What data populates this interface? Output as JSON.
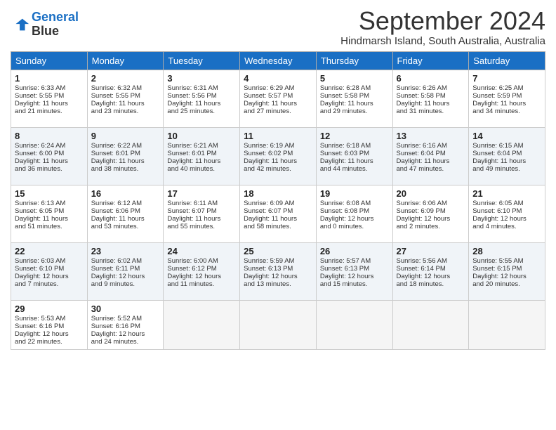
{
  "logo": {
    "line1": "General",
    "line2": "Blue"
  },
  "title": "September 2024",
  "location": "Hindmarsh Island, South Australia, Australia",
  "headers": [
    "Sunday",
    "Monday",
    "Tuesday",
    "Wednesday",
    "Thursday",
    "Friday",
    "Saturday"
  ],
  "weeks": [
    [
      {
        "day": "1",
        "sunrise": "Sunrise: 6:33 AM",
        "sunset": "Sunset: 5:55 PM",
        "daylight": "Daylight: 11 hours",
        "minutes": "and 21 minutes."
      },
      {
        "day": "2",
        "sunrise": "Sunrise: 6:32 AM",
        "sunset": "Sunset: 5:55 PM",
        "daylight": "Daylight: 11 hours",
        "minutes": "and 23 minutes."
      },
      {
        "day": "3",
        "sunrise": "Sunrise: 6:31 AM",
        "sunset": "Sunset: 5:56 PM",
        "daylight": "Daylight: 11 hours",
        "minutes": "and 25 minutes."
      },
      {
        "day": "4",
        "sunrise": "Sunrise: 6:29 AM",
        "sunset": "Sunset: 5:57 PM",
        "daylight": "Daylight: 11 hours",
        "minutes": "and 27 minutes."
      },
      {
        "day": "5",
        "sunrise": "Sunrise: 6:28 AM",
        "sunset": "Sunset: 5:58 PM",
        "daylight": "Daylight: 11 hours",
        "minutes": "and 29 minutes."
      },
      {
        "day": "6",
        "sunrise": "Sunrise: 6:26 AM",
        "sunset": "Sunset: 5:58 PM",
        "daylight": "Daylight: 11 hours",
        "minutes": "and 31 minutes."
      },
      {
        "day": "7",
        "sunrise": "Sunrise: 6:25 AM",
        "sunset": "Sunset: 5:59 PM",
        "daylight": "Daylight: 11 hours",
        "minutes": "and 34 minutes."
      }
    ],
    [
      {
        "day": "8",
        "sunrise": "Sunrise: 6:24 AM",
        "sunset": "Sunset: 6:00 PM",
        "daylight": "Daylight: 11 hours",
        "minutes": "and 36 minutes."
      },
      {
        "day": "9",
        "sunrise": "Sunrise: 6:22 AM",
        "sunset": "Sunset: 6:01 PM",
        "daylight": "Daylight: 11 hours",
        "minutes": "and 38 minutes."
      },
      {
        "day": "10",
        "sunrise": "Sunrise: 6:21 AM",
        "sunset": "Sunset: 6:01 PM",
        "daylight": "Daylight: 11 hours",
        "minutes": "and 40 minutes."
      },
      {
        "day": "11",
        "sunrise": "Sunrise: 6:19 AM",
        "sunset": "Sunset: 6:02 PM",
        "daylight": "Daylight: 11 hours",
        "minutes": "and 42 minutes."
      },
      {
        "day": "12",
        "sunrise": "Sunrise: 6:18 AM",
        "sunset": "Sunset: 6:03 PM",
        "daylight": "Daylight: 11 hours",
        "minutes": "and 44 minutes."
      },
      {
        "day": "13",
        "sunrise": "Sunrise: 6:16 AM",
        "sunset": "Sunset: 6:04 PM",
        "daylight": "Daylight: 11 hours",
        "minutes": "and 47 minutes."
      },
      {
        "day": "14",
        "sunrise": "Sunrise: 6:15 AM",
        "sunset": "Sunset: 6:04 PM",
        "daylight": "Daylight: 11 hours",
        "minutes": "and 49 minutes."
      }
    ],
    [
      {
        "day": "15",
        "sunrise": "Sunrise: 6:13 AM",
        "sunset": "Sunset: 6:05 PM",
        "daylight": "Daylight: 11 hours",
        "minutes": "and 51 minutes."
      },
      {
        "day": "16",
        "sunrise": "Sunrise: 6:12 AM",
        "sunset": "Sunset: 6:06 PM",
        "daylight": "Daylight: 11 hours",
        "minutes": "and 53 minutes."
      },
      {
        "day": "17",
        "sunrise": "Sunrise: 6:11 AM",
        "sunset": "Sunset: 6:07 PM",
        "daylight": "Daylight: 11 hours",
        "minutes": "and 55 minutes."
      },
      {
        "day": "18",
        "sunrise": "Sunrise: 6:09 AM",
        "sunset": "Sunset: 6:07 PM",
        "daylight": "Daylight: 11 hours",
        "minutes": "and 58 minutes."
      },
      {
        "day": "19",
        "sunrise": "Sunrise: 6:08 AM",
        "sunset": "Sunset: 6:08 PM",
        "daylight": "Daylight: 12 hours",
        "minutes": "and 0 minutes."
      },
      {
        "day": "20",
        "sunrise": "Sunrise: 6:06 AM",
        "sunset": "Sunset: 6:09 PM",
        "daylight": "Daylight: 12 hours",
        "minutes": "and 2 minutes."
      },
      {
        "day": "21",
        "sunrise": "Sunrise: 6:05 AM",
        "sunset": "Sunset: 6:10 PM",
        "daylight": "Daylight: 12 hours",
        "minutes": "and 4 minutes."
      }
    ],
    [
      {
        "day": "22",
        "sunrise": "Sunrise: 6:03 AM",
        "sunset": "Sunset: 6:10 PM",
        "daylight": "Daylight: 12 hours",
        "minutes": "and 7 minutes."
      },
      {
        "day": "23",
        "sunrise": "Sunrise: 6:02 AM",
        "sunset": "Sunset: 6:11 PM",
        "daylight": "Daylight: 12 hours",
        "minutes": "and 9 minutes."
      },
      {
        "day": "24",
        "sunrise": "Sunrise: 6:00 AM",
        "sunset": "Sunset: 6:12 PM",
        "daylight": "Daylight: 12 hours",
        "minutes": "and 11 minutes."
      },
      {
        "day": "25",
        "sunrise": "Sunrise: 5:59 AM",
        "sunset": "Sunset: 6:13 PM",
        "daylight": "Daylight: 12 hours",
        "minutes": "and 13 minutes."
      },
      {
        "day": "26",
        "sunrise": "Sunrise: 5:57 AM",
        "sunset": "Sunset: 6:13 PM",
        "daylight": "Daylight: 12 hours",
        "minutes": "and 15 minutes."
      },
      {
        "day": "27",
        "sunrise": "Sunrise: 5:56 AM",
        "sunset": "Sunset: 6:14 PM",
        "daylight": "Daylight: 12 hours",
        "minutes": "and 18 minutes."
      },
      {
        "day": "28",
        "sunrise": "Sunrise: 5:55 AM",
        "sunset": "Sunset: 6:15 PM",
        "daylight": "Daylight: 12 hours",
        "minutes": "and 20 minutes."
      }
    ],
    [
      {
        "day": "29",
        "sunrise": "Sunrise: 5:53 AM",
        "sunset": "Sunset: 6:16 PM",
        "daylight": "Daylight: 12 hours",
        "minutes": "and 22 minutes."
      },
      {
        "day": "30",
        "sunrise": "Sunrise: 5:52 AM",
        "sunset": "Sunset: 6:16 PM",
        "daylight": "Daylight: 12 hours",
        "minutes": "and 24 minutes."
      },
      null,
      null,
      null,
      null,
      null
    ]
  ]
}
